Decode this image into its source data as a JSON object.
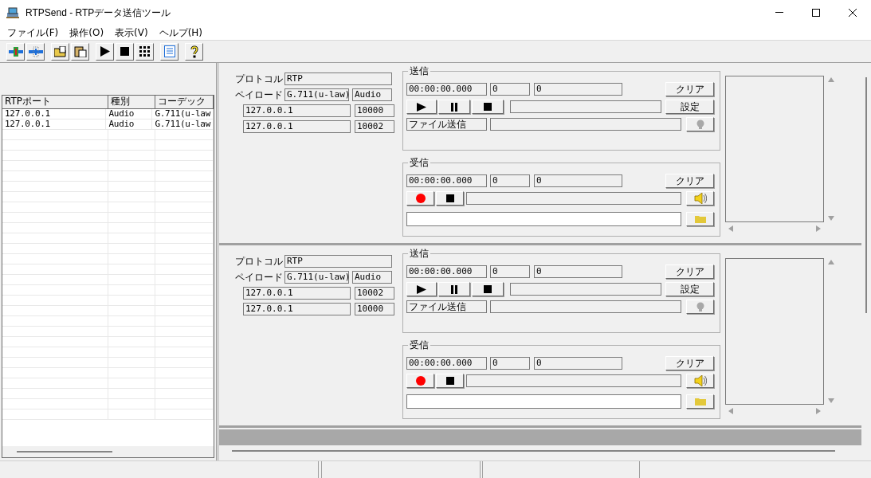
{
  "window": {
    "title": "RTPSend - RTPデータ送信ツール"
  },
  "menu": [
    "ファイル(F)",
    "操作(O)",
    "表示(V)",
    "ヘルプ(H)"
  ],
  "ports_table": {
    "columns": [
      "RTPポート",
      "種別",
      "コーデック"
    ],
    "rows": [
      [
        "127.0.0.1",
        "Audio",
        "G.711(u-law"
      ],
      [
        "127.0.0.1",
        "Audio",
        "G.711(u-law"
      ]
    ]
  },
  "channels": [
    {
      "protocol_label": "プロトコル",
      "protocol": "RTP",
      "payload_label": "ペイロード",
      "payload": "G.711(u-law)",
      "media": "Audio",
      "address_1": "127.0.0.1",
      "port_1": "10000",
      "address_2": "127.0.0.1",
      "port_2": "10002",
      "send": {
        "title": "送信",
        "time": "00:00:00.000",
        "count_1": "0",
        "count_2": "0",
        "clear": "クリア",
        "settings": "設定",
        "file_send": "ファイル送信"
      },
      "receive": {
        "title": "受信",
        "time": "00:00:00.000",
        "count_1": "0",
        "count_2": "0",
        "clear": "クリア"
      }
    },
    {
      "protocol_label": "プロトコル",
      "protocol": "RTP",
      "payload_label": "ペイロード",
      "payload": "G.711(u-law)",
      "media": "Audio",
      "address_1": "127.0.0.1",
      "port_1": "10002",
      "address_2": "127.0.0.1",
      "port_2": "10000",
      "send": {
        "title": "送信",
        "time": "00:00:00.000",
        "count_1": "0",
        "count_2": "0",
        "clear": "クリア",
        "settings": "設定",
        "file_send": "ファイル送信"
      },
      "receive": {
        "title": "受信",
        "time": "00:00:00.000",
        "count_1": "0",
        "count_2": "0",
        "clear": "クリア"
      }
    }
  ]
}
